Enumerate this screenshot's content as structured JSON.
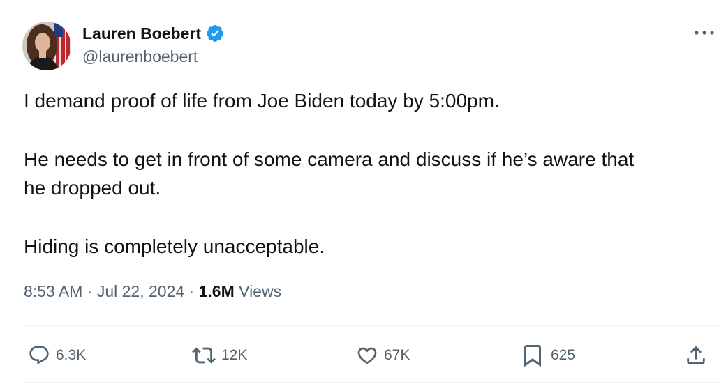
{
  "author": {
    "display_name": "Lauren Boebert",
    "handle": "@laurenboebert",
    "verified": true
  },
  "tweet": {
    "paragraphs": [
      "I demand proof of life from Joe Biden today by 5:00pm.",
      "He needs to get in front of some camera and discuss if he’s aware that\nhe dropped out.",
      "Hiding is completely unacceptable."
    ],
    "time": "8:53 AM",
    "date": "Jul 22, 2024",
    "separator": "·",
    "views_count": "1.6M",
    "views_label": "Views"
  },
  "actions": {
    "replies": "6.3K",
    "reposts": "12K",
    "likes": "67K",
    "bookmarks": "625"
  },
  "colors": {
    "text_primary": "#0f1419",
    "text_secondary": "#536471",
    "verified_blue": "#1d9bf0",
    "divider": "#eff3f4"
  },
  "icons": {
    "verified": "verified-badge-icon",
    "more": "more-options-icon",
    "reply": "reply-icon",
    "repost": "repost-icon",
    "like": "heart-icon",
    "bookmark": "bookmark-icon",
    "share": "share-icon"
  }
}
